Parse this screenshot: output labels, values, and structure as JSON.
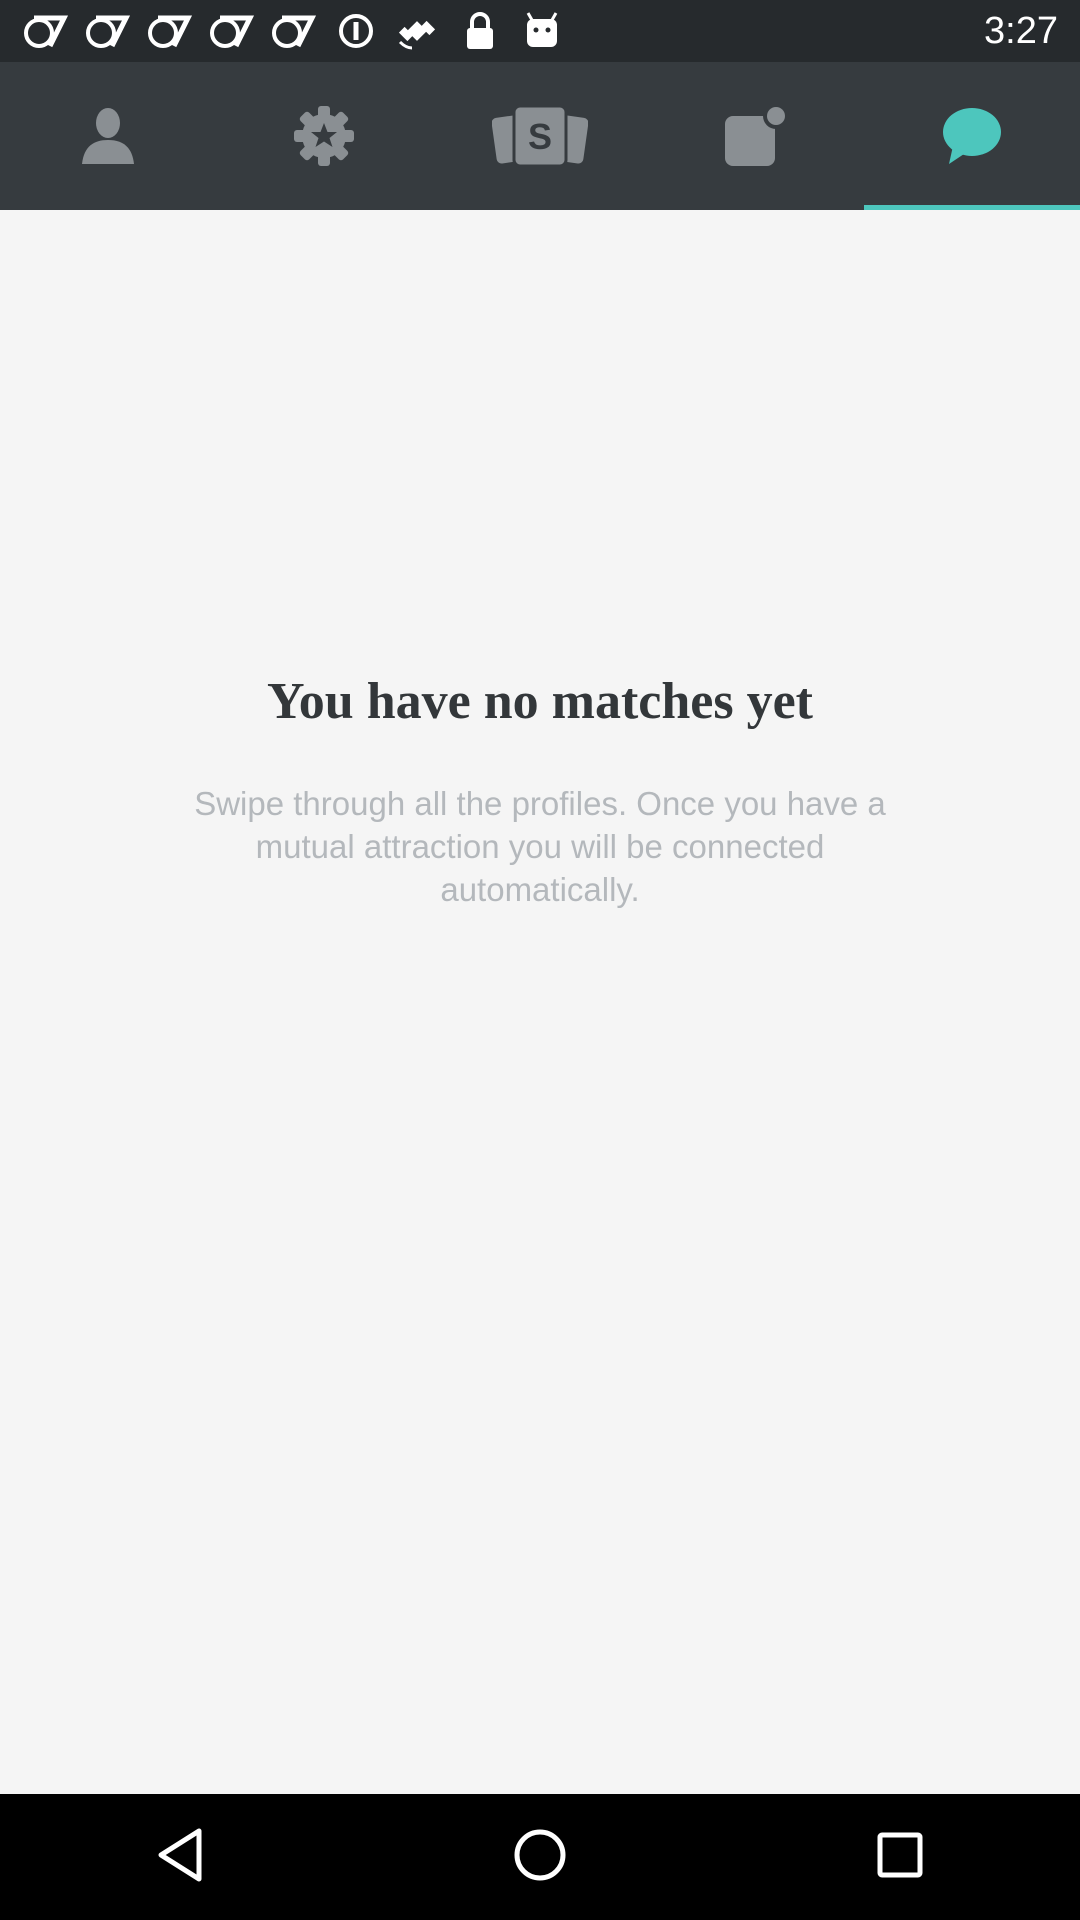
{
  "status_bar": {
    "time": "3:27",
    "icons": [
      "abc7-icon",
      "abc7-icon",
      "abc7-icon",
      "abc7-icon",
      "abc7-icon",
      "info-icon",
      "fake-gps-icon",
      "lock-icon",
      "android-icon"
    ]
  },
  "tabs": [
    {
      "icon": "profile-icon",
      "active": false
    },
    {
      "icon": "settings-star-icon",
      "active": false
    },
    {
      "icon": "cards-icon",
      "active": false
    },
    {
      "icon": "notifications-icon",
      "active": false
    },
    {
      "icon": "chat-icon",
      "active": true
    }
  ],
  "empty_state": {
    "title": "You have no matches yet",
    "body": "Swipe through all the profiles. Once you have a mutual attraction you will be connected automatically."
  },
  "nav_bar": {
    "buttons": [
      "back-icon",
      "home-icon",
      "recents-icon"
    ]
  },
  "colors": {
    "status_bar_bg": "#262a2d",
    "tab_bar_bg": "#363b3f",
    "accent": "#4dc6bd",
    "inactive_icon": "#8a8f93",
    "background": "#f5f5f5",
    "title_text": "#33373a",
    "body_text": "#b4b8bc"
  }
}
